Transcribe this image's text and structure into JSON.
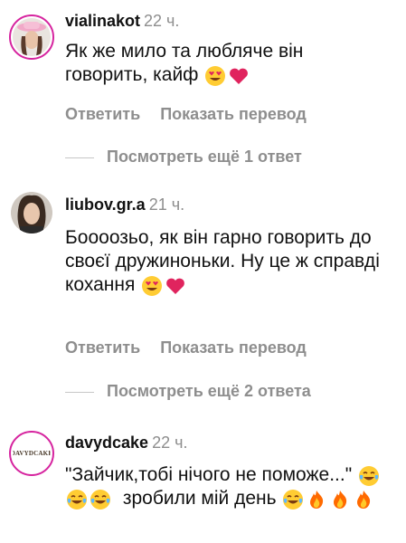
{
  "comments": [
    {
      "username": "vialinakot",
      "time": "22 ч.",
      "text": "Як же мило та любляче він говорить, кайф",
      "emojis": [
        "heart-eyes",
        "red-heart"
      ],
      "reply_label": "Ответить",
      "translate_label": "Показать перевод",
      "more_replies": "Посмотреть ещё 1 ответ"
    },
    {
      "username": "liubov.gr.a",
      "time": "21 ч.",
      "text": "Бoooозьо, як він гарно говорить до своєї дружиноньки. Ну це ж справді кохання",
      "emojis": [
        "heart-eyes",
        "red-heart"
      ],
      "reply_label": "Ответить",
      "translate_label": "Показать перевод",
      "more_replies": "Посмотреть ещё 2 ответа"
    },
    {
      "username": "davydcake",
      "time": "22 ч.",
      "avatar_text": "DAVYDCAKE",
      "text_part1": "\"Зайчик,тобі нічого не поможе...\"",
      "text_part2": "зробили мій день",
      "emojis_part1": [
        "tears-of-joy",
        "tears-of-joy",
        "tears-of-joy"
      ],
      "emojis_part2": [
        "tears-of-joy",
        "fire",
        "fire",
        "fire"
      ]
    }
  ],
  "colors": {
    "secondary_text": "#8e8e8e",
    "story_ring": "#d6249f",
    "heart": "#e0245e"
  }
}
